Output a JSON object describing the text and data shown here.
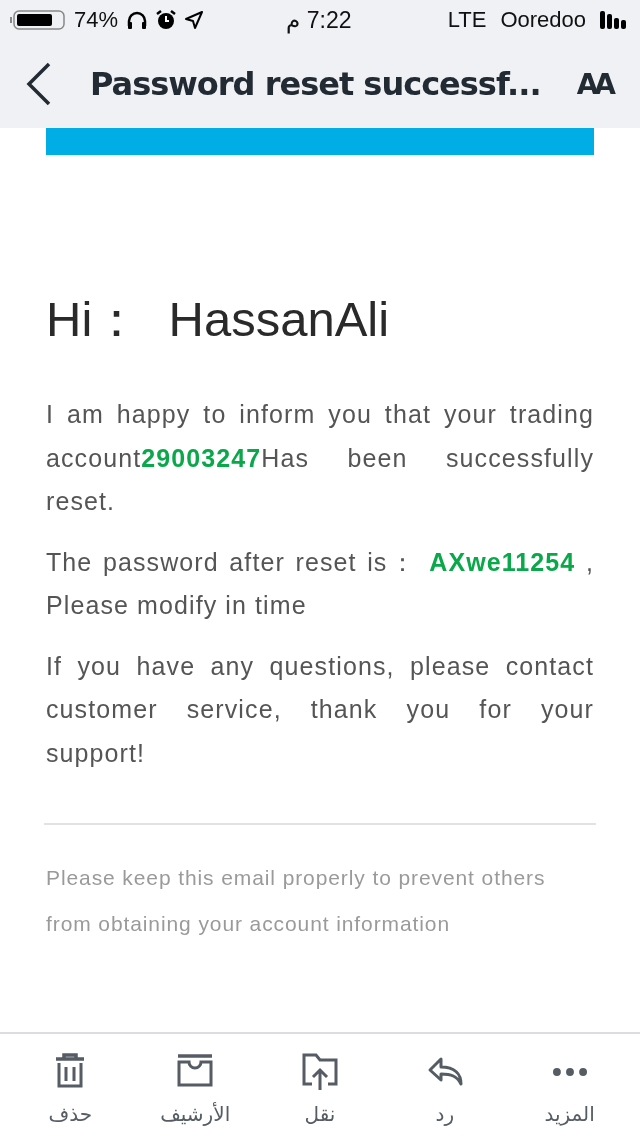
{
  "status_bar": {
    "battery": "74%",
    "time": "7:22 م",
    "network": "LTE",
    "carrier": "Ooredoo"
  },
  "nav": {
    "title": "Password reset successf...",
    "text_size_button": "AA"
  },
  "email": {
    "greeting": "Hi：  HassanAli",
    "paragraphs": [
      "I am happy to inform you that your trading account**29003247**Has been successfully reset.",
      "The password after reset is： **AXwe11254** , Please modify in time",
      "If you have any questions, please contact customer service, thank you for your support!"
    ],
    "footer_note": "Please keep this email properly to prevent others from obtaining your account information"
  },
  "toolbar": [
    {
      "kind": "more",
      "label": "المزيد"
    },
    {
      "kind": "reply",
      "label": "رد"
    },
    {
      "kind": "move",
      "label": "نقل"
    },
    {
      "kind": "archive",
      "label": "الأرشيف"
    },
    {
      "kind": "trash",
      "label": "حذف"
    }
  ]
}
